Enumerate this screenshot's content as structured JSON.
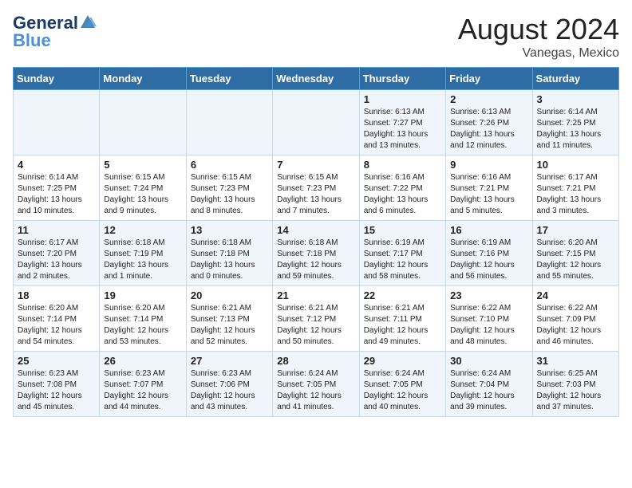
{
  "header": {
    "logo_general": "General",
    "logo_blue": "Blue",
    "month_year": "August 2024",
    "location": "Vanegas, Mexico"
  },
  "days_of_week": [
    "Sunday",
    "Monday",
    "Tuesday",
    "Wednesday",
    "Thursday",
    "Friday",
    "Saturday"
  ],
  "weeks": [
    [
      {
        "day": "",
        "info": ""
      },
      {
        "day": "",
        "info": ""
      },
      {
        "day": "",
        "info": ""
      },
      {
        "day": "",
        "info": ""
      },
      {
        "day": "1",
        "info": "Sunrise: 6:13 AM\nSunset: 7:27 PM\nDaylight: 13 hours\nand 13 minutes."
      },
      {
        "day": "2",
        "info": "Sunrise: 6:13 AM\nSunset: 7:26 PM\nDaylight: 13 hours\nand 12 minutes."
      },
      {
        "day": "3",
        "info": "Sunrise: 6:14 AM\nSunset: 7:25 PM\nDaylight: 13 hours\nand 11 minutes."
      }
    ],
    [
      {
        "day": "4",
        "info": "Sunrise: 6:14 AM\nSunset: 7:25 PM\nDaylight: 13 hours\nand 10 minutes."
      },
      {
        "day": "5",
        "info": "Sunrise: 6:15 AM\nSunset: 7:24 PM\nDaylight: 13 hours\nand 9 minutes."
      },
      {
        "day": "6",
        "info": "Sunrise: 6:15 AM\nSunset: 7:23 PM\nDaylight: 13 hours\nand 8 minutes."
      },
      {
        "day": "7",
        "info": "Sunrise: 6:15 AM\nSunset: 7:23 PM\nDaylight: 13 hours\nand 7 minutes."
      },
      {
        "day": "8",
        "info": "Sunrise: 6:16 AM\nSunset: 7:22 PM\nDaylight: 13 hours\nand 6 minutes."
      },
      {
        "day": "9",
        "info": "Sunrise: 6:16 AM\nSunset: 7:21 PM\nDaylight: 13 hours\nand 5 minutes."
      },
      {
        "day": "10",
        "info": "Sunrise: 6:17 AM\nSunset: 7:21 PM\nDaylight: 13 hours\nand 3 minutes."
      }
    ],
    [
      {
        "day": "11",
        "info": "Sunrise: 6:17 AM\nSunset: 7:20 PM\nDaylight: 13 hours\nand 2 minutes."
      },
      {
        "day": "12",
        "info": "Sunrise: 6:18 AM\nSunset: 7:19 PM\nDaylight: 13 hours\nand 1 minute."
      },
      {
        "day": "13",
        "info": "Sunrise: 6:18 AM\nSunset: 7:18 PM\nDaylight: 13 hours\nand 0 minutes."
      },
      {
        "day": "14",
        "info": "Sunrise: 6:18 AM\nSunset: 7:18 PM\nDaylight: 12 hours\nand 59 minutes."
      },
      {
        "day": "15",
        "info": "Sunrise: 6:19 AM\nSunset: 7:17 PM\nDaylight: 12 hours\nand 58 minutes."
      },
      {
        "day": "16",
        "info": "Sunrise: 6:19 AM\nSunset: 7:16 PM\nDaylight: 12 hours\nand 56 minutes."
      },
      {
        "day": "17",
        "info": "Sunrise: 6:20 AM\nSunset: 7:15 PM\nDaylight: 12 hours\nand 55 minutes."
      }
    ],
    [
      {
        "day": "18",
        "info": "Sunrise: 6:20 AM\nSunset: 7:14 PM\nDaylight: 12 hours\nand 54 minutes."
      },
      {
        "day": "19",
        "info": "Sunrise: 6:20 AM\nSunset: 7:14 PM\nDaylight: 12 hours\nand 53 minutes."
      },
      {
        "day": "20",
        "info": "Sunrise: 6:21 AM\nSunset: 7:13 PM\nDaylight: 12 hours\nand 52 minutes."
      },
      {
        "day": "21",
        "info": "Sunrise: 6:21 AM\nSunset: 7:12 PM\nDaylight: 12 hours\nand 50 minutes."
      },
      {
        "day": "22",
        "info": "Sunrise: 6:21 AM\nSunset: 7:11 PM\nDaylight: 12 hours\nand 49 minutes."
      },
      {
        "day": "23",
        "info": "Sunrise: 6:22 AM\nSunset: 7:10 PM\nDaylight: 12 hours\nand 48 minutes."
      },
      {
        "day": "24",
        "info": "Sunrise: 6:22 AM\nSunset: 7:09 PM\nDaylight: 12 hours\nand 46 minutes."
      }
    ],
    [
      {
        "day": "25",
        "info": "Sunrise: 6:23 AM\nSunset: 7:08 PM\nDaylight: 12 hours\nand 45 minutes."
      },
      {
        "day": "26",
        "info": "Sunrise: 6:23 AM\nSunset: 7:07 PM\nDaylight: 12 hours\nand 44 minutes."
      },
      {
        "day": "27",
        "info": "Sunrise: 6:23 AM\nSunset: 7:06 PM\nDaylight: 12 hours\nand 43 minutes."
      },
      {
        "day": "28",
        "info": "Sunrise: 6:24 AM\nSunset: 7:05 PM\nDaylight: 12 hours\nand 41 minutes."
      },
      {
        "day": "29",
        "info": "Sunrise: 6:24 AM\nSunset: 7:05 PM\nDaylight: 12 hours\nand 40 minutes."
      },
      {
        "day": "30",
        "info": "Sunrise: 6:24 AM\nSunset: 7:04 PM\nDaylight: 12 hours\nand 39 minutes."
      },
      {
        "day": "31",
        "info": "Sunrise: 6:25 AM\nSunset: 7:03 PM\nDaylight: 12 hours\nand 37 minutes."
      }
    ]
  ]
}
